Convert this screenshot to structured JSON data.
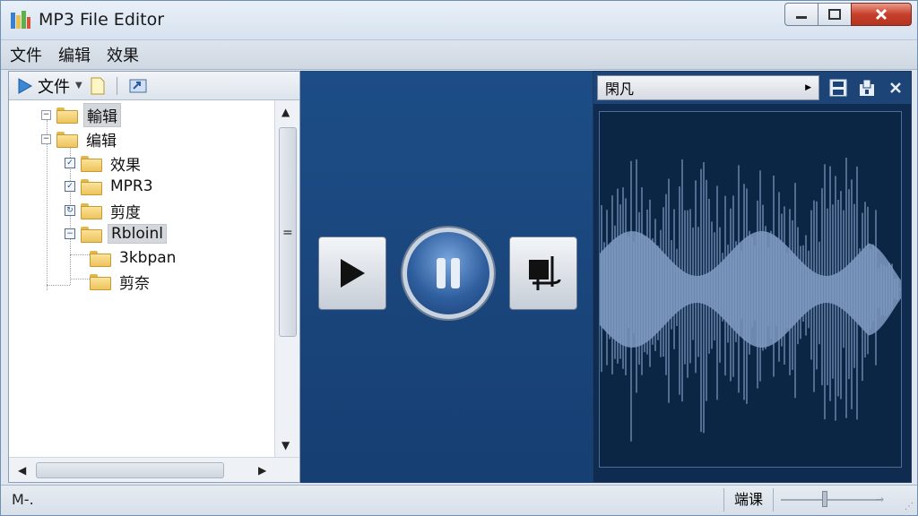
{
  "window": {
    "title": "MP3 File Editor",
    "controls": {
      "minimize": "minimize-icon",
      "maximize": "maximize-icon",
      "close": "close-icon"
    }
  },
  "menu": {
    "items": [
      "文件",
      "编辑",
      "效果"
    ]
  },
  "left_toolbar": {
    "label": "文件"
  },
  "tree": {
    "items": [
      {
        "label": "輸辑",
        "selected": true
      },
      {
        "label": "编辑",
        "selected": false
      },
      {
        "label": "效果",
        "selected": false
      },
      {
        "label": "MPR3",
        "selected": false
      },
      {
        "label": "剪度",
        "selected": false
      },
      {
        "label": "Rbloinl",
        "selected": true
      },
      {
        "label": "3kbpan",
        "selected": false
      },
      {
        "label": "剪奈",
        "selected": false
      }
    ]
  },
  "player": {
    "play_icon": "play-icon",
    "pause_icon": "pause-icon",
    "stop_icon": "stop-edit-icon"
  },
  "right_panel": {
    "dropdown_value": "閑凡",
    "icons": [
      "save-icon",
      "export-icon",
      "close-icon"
    ]
  },
  "status": {
    "left": "M-.",
    "segment": "端课"
  },
  "colors": {
    "title_bar": "#dbe5f0",
    "player_bg": "#1b4780",
    "waveform": "#7f9bc2",
    "close_button": "#c7402c"
  }
}
